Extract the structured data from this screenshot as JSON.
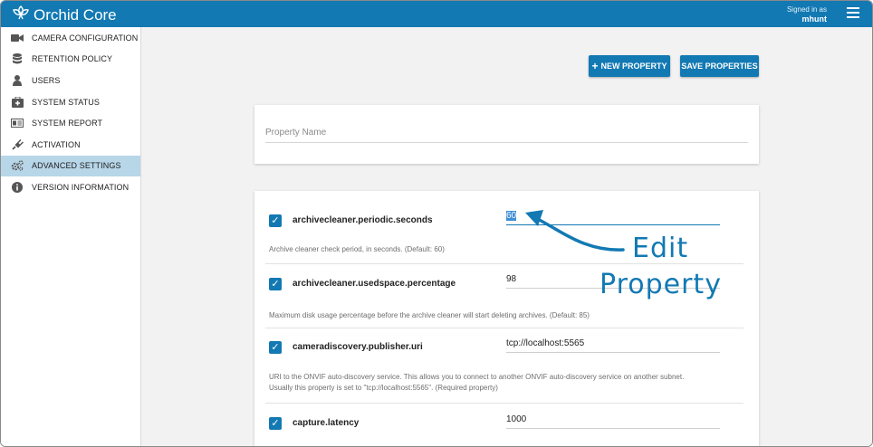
{
  "app": {
    "title": "Orchid Core",
    "signed_in_label": "Signed in as",
    "username": "mhunt"
  },
  "sidebar": {
    "items": [
      {
        "label": "CAMERA CONFIGURATION",
        "icon": "video-camera-icon"
      },
      {
        "label": "RETENTION POLICY",
        "icon": "database-icon"
      },
      {
        "label": "USERS",
        "icon": "user-icon"
      },
      {
        "label": "SYSTEM STATUS",
        "icon": "medkit-icon"
      },
      {
        "label": "SYSTEM REPORT",
        "icon": "id-card-icon"
      },
      {
        "label": "ACTIVATION",
        "icon": "plug-icon"
      },
      {
        "label": "ADVANCED SETTINGS",
        "icon": "gears-icon",
        "active": true
      },
      {
        "label": "VERSION INFORMATION",
        "icon": "info-circle-icon"
      }
    ]
  },
  "toolbar": {
    "new_property_label": "NEW PROPERTY",
    "save_properties_label": "SAVE PROPERTIES"
  },
  "search": {
    "placeholder": "Property Name",
    "value": ""
  },
  "properties": [
    {
      "name": "archivecleaner.periodic.seconds",
      "value": "60",
      "checked": true,
      "description": "Archive cleaner check period, in seconds. (Default: 60)"
    },
    {
      "name": "archivecleaner.usedspace.percentage",
      "value": "98",
      "checked": true,
      "description": "Maximum disk usage percentage before the archive cleaner will start deleting archives. (Default: 85)"
    },
    {
      "name": "cameradiscovery.publisher.uri",
      "value": "tcp://localhost:5565",
      "checked": true,
      "description_line1": "URI to the ONVIF auto-discovery service. This allows you to connect to another ONVIF auto-discovery service on another subnet.",
      "description_line2": "Usually this property is set to \"tcp://localhost:5565\". (Required property)"
    },
    {
      "name": "capture.latency",
      "value": "1000",
      "checked": true
    }
  ],
  "annotation": {
    "line1": "Edit",
    "line2": "Property"
  },
  "colors": {
    "brand": "#1279b3",
    "active_nav": "#b7d6e8",
    "background": "#f2f2f2"
  }
}
